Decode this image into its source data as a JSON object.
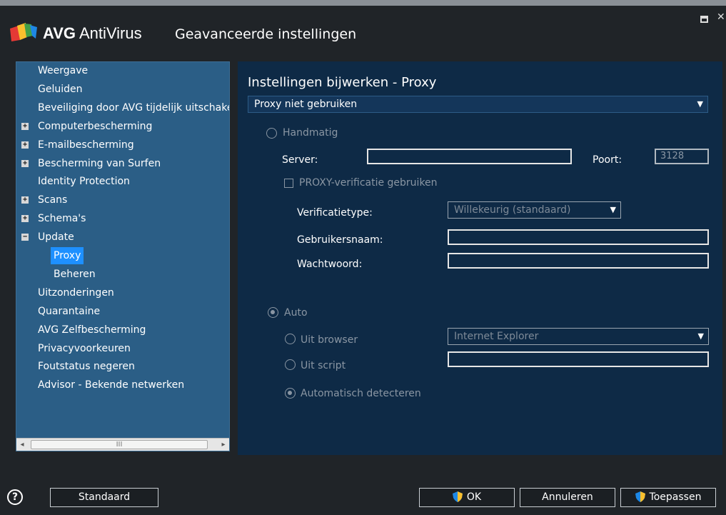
{
  "app": {
    "brand_bold": "AVG",
    "brand_rest": "AntiVirus",
    "window_title": "Geavanceerde instellingen"
  },
  "sidebar": {
    "items": [
      {
        "label": "Weergave",
        "expander": ""
      },
      {
        "label": "Geluiden",
        "expander": ""
      },
      {
        "label": "Beveiliging door AVG tijdelijk uitschakelen",
        "expander": ""
      },
      {
        "label": "Computerbescherming",
        "expander": "+"
      },
      {
        "label": "E-mailbescherming",
        "expander": "+"
      },
      {
        "label": "Bescherming van Surfen",
        "expander": "+"
      },
      {
        "label": "Identity Protection",
        "expander": ""
      },
      {
        "label": "Scans",
        "expander": "+"
      },
      {
        "label": "Schema's",
        "expander": "+"
      },
      {
        "label": "Update",
        "expander": "−"
      },
      {
        "label": "Proxy",
        "expander": "",
        "selected": true
      },
      {
        "label": "Beheren",
        "expander": ""
      },
      {
        "label": "Uitzonderingen",
        "expander": ""
      },
      {
        "label": "Quarantaine",
        "expander": ""
      },
      {
        "label": "AVG Zelfbescherming",
        "expander": ""
      },
      {
        "label": "Privacyvoorkeuren",
        "expander": ""
      },
      {
        "label": "Foutstatus negeren",
        "expander": ""
      },
      {
        "label": "Advisor - Bekende netwerken",
        "expander": ""
      }
    ],
    "scroll_left": "◂",
    "scroll_right": "▸",
    "scroll_grip": "III"
  },
  "main": {
    "title": "Instellingen bijwerken - Proxy",
    "proxy_mode": "Proxy niet gebruiken",
    "manual_label": "Handmatig",
    "server_label": "Server:",
    "server_value": "",
    "port_label": "Poort:",
    "port_value": "3128",
    "proxy_auth_label": "PROXY-verificatie gebruiken",
    "auth_type_label": "Verificatietype:",
    "auth_type_value": "Willekeurig (standaard)",
    "username_label": "Gebruikersnaam:",
    "password_label": "Wachtwoord:",
    "auto_label": "Auto",
    "from_browser_label": "Uit browser",
    "browser_value": "Internet Explorer",
    "from_script_label": "Uit script",
    "auto_detect_label": "Automatisch detecteren",
    "caret": "▼"
  },
  "footer": {
    "help": "?",
    "default_label": "Standaard",
    "ok_label": "OK",
    "cancel_label": "Annuleren",
    "apply_label": "Toepassen"
  },
  "colors": {
    "selected": "#1e90ff",
    "sidebar_bg": "#2b5e86",
    "content_bg": "#0e2a46",
    "window_bg": "#202428"
  }
}
